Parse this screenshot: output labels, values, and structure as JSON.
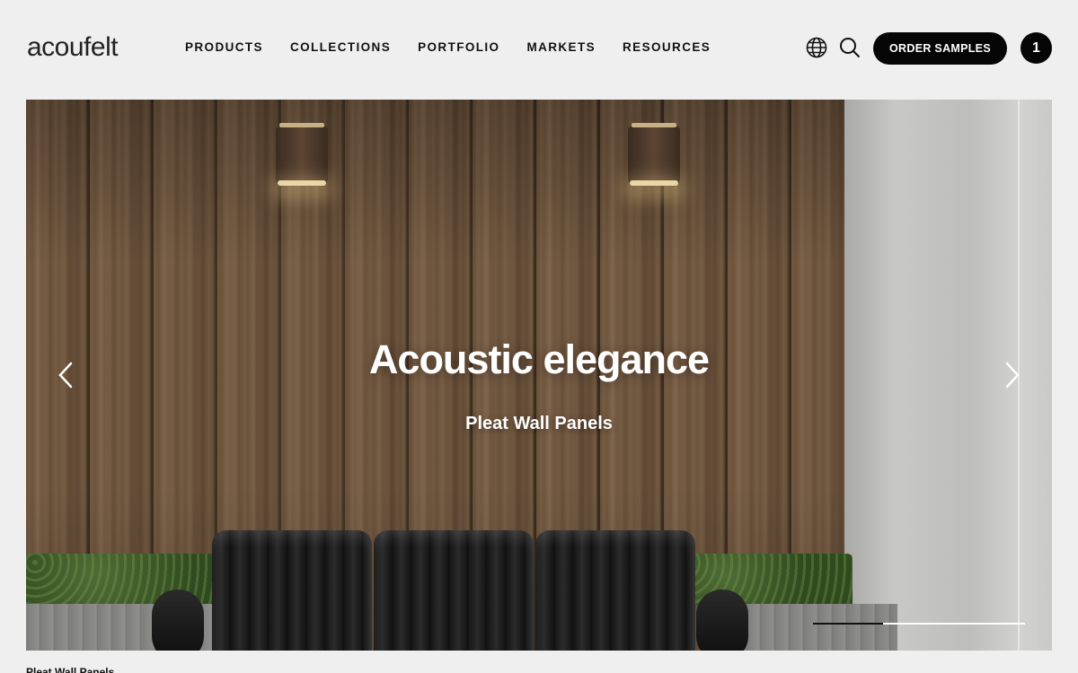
{
  "header": {
    "logo": {
      "text": "acoufelt"
    },
    "nav": [
      {
        "label": "PRODUCTS"
      },
      {
        "label": "COLLECTIONS"
      },
      {
        "label": "PORTFOLIO"
      },
      {
        "label": "MARKETS"
      },
      {
        "label": "RESOURCES"
      }
    ],
    "icons": {
      "language": "globe-icon",
      "search": "search-icon"
    },
    "order_button": "ORDER SAMPLES",
    "cart_count": "1"
  },
  "hero": {
    "title": "Acoustic elegance",
    "subtitle": "Pleat Wall Panels",
    "slide_progress": 0.33,
    "prev_icon": "chevron-left-icon",
    "next_icon": "chevron-right-icon"
  },
  "caption": "Pleat Wall Panels",
  "colors": {
    "button_bg": "#050505",
    "page_bg": "#efefef",
    "text": "#111111"
  }
}
